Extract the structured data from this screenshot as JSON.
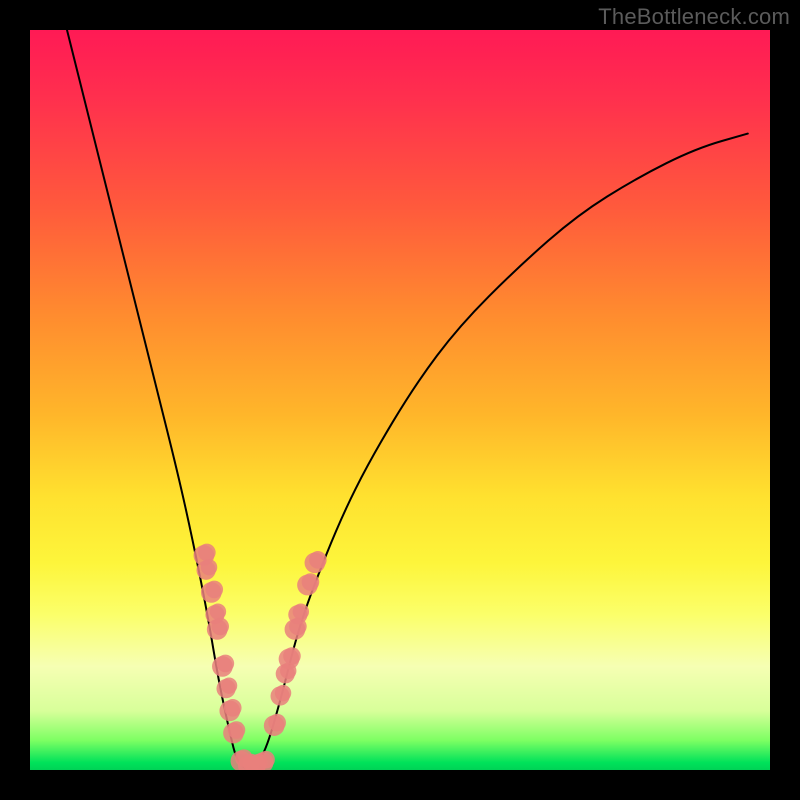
{
  "watermark": "TheBottleneck.com",
  "colors": {
    "frame": "#000000",
    "watermark": "#5b5b5b",
    "curve": "#000000",
    "marker": "#e9807d",
    "gradient_top": "#ff1a55",
    "gradient_bottom": "#00d256"
  },
  "chart_data": {
    "type": "line",
    "title": "",
    "xlabel": "",
    "ylabel": "",
    "xlim": [
      0,
      100
    ],
    "ylim": [
      0,
      100
    ],
    "grid": false,
    "legend": false,
    "note": "No axis tick labels are shown; x and y are normalized 0–100. y=0 is bottom (green/good), y=100 is top (red/bad). The curve is a V-shaped bottleneck profile.",
    "series": [
      {
        "name": "bottleneck-curve",
        "x": [
          5,
          8,
          11,
          14,
          17,
          20,
          22,
          24,
          25.5,
          27,
          28,
          29.5,
          30.5,
          32,
          34,
          36,
          38,
          42,
          46,
          52,
          58,
          66,
          74,
          82,
          90,
          97
        ],
        "y": [
          100,
          88,
          76,
          64,
          52,
          40,
          31,
          21,
          12,
          5,
          1,
          0,
          0.5,
          3,
          10,
          18,
          24,
          34,
          42,
          52,
          60,
          68,
          75,
          80,
          84,
          86
        ]
      }
    ],
    "markers_left": {
      "note": "Bead cluster on left arm of V (screen x,y in 0–100 plot space)",
      "points": [
        {
          "x": 23.5,
          "y": 29,
          "r": 1.4
        },
        {
          "x": 23.8,
          "y": 27,
          "r": 1.3
        },
        {
          "x": 24.5,
          "y": 24,
          "r": 1.4
        },
        {
          "x": 25.0,
          "y": 21,
          "r": 1.3
        },
        {
          "x": 25.3,
          "y": 19,
          "r": 1.4
        },
        {
          "x": 26.0,
          "y": 14,
          "r": 1.4
        },
        {
          "x": 26.5,
          "y": 11,
          "r": 1.3
        },
        {
          "x": 27.0,
          "y": 8,
          "r": 1.4
        },
        {
          "x": 27.5,
          "y": 5,
          "r": 1.4
        }
      ]
    },
    "markers_bottom": {
      "note": "Flat cluster at bottom of V",
      "points": [
        {
          "x": 28.5,
          "y": 1.2,
          "r": 1.4
        },
        {
          "x": 29.5,
          "y": 0.6,
          "r": 1.4
        },
        {
          "x": 30.5,
          "y": 0.6,
          "r": 1.4
        },
        {
          "x": 31.5,
          "y": 1.0,
          "r": 1.4
        }
      ]
    },
    "markers_right": {
      "note": "Bead cluster on right arm of V",
      "points": [
        {
          "x": 33.0,
          "y": 6,
          "r": 1.4
        },
        {
          "x": 33.8,
          "y": 10,
          "r": 1.3
        },
        {
          "x": 34.5,
          "y": 13,
          "r": 1.3
        },
        {
          "x": 35.0,
          "y": 15,
          "r": 1.4
        },
        {
          "x": 35.8,
          "y": 19,
          "r": 1.4
        },
        {
          "x": 36.2,
          "y": 21,
          "r": 1.3
        },
        {
          "x": 37.5,
          "y": 25,
          "r": 1.4
        },
        {
          "x": 38.5,
          "y": 28,
          "r": 1.4
        }
      ]
    }
  }
}
